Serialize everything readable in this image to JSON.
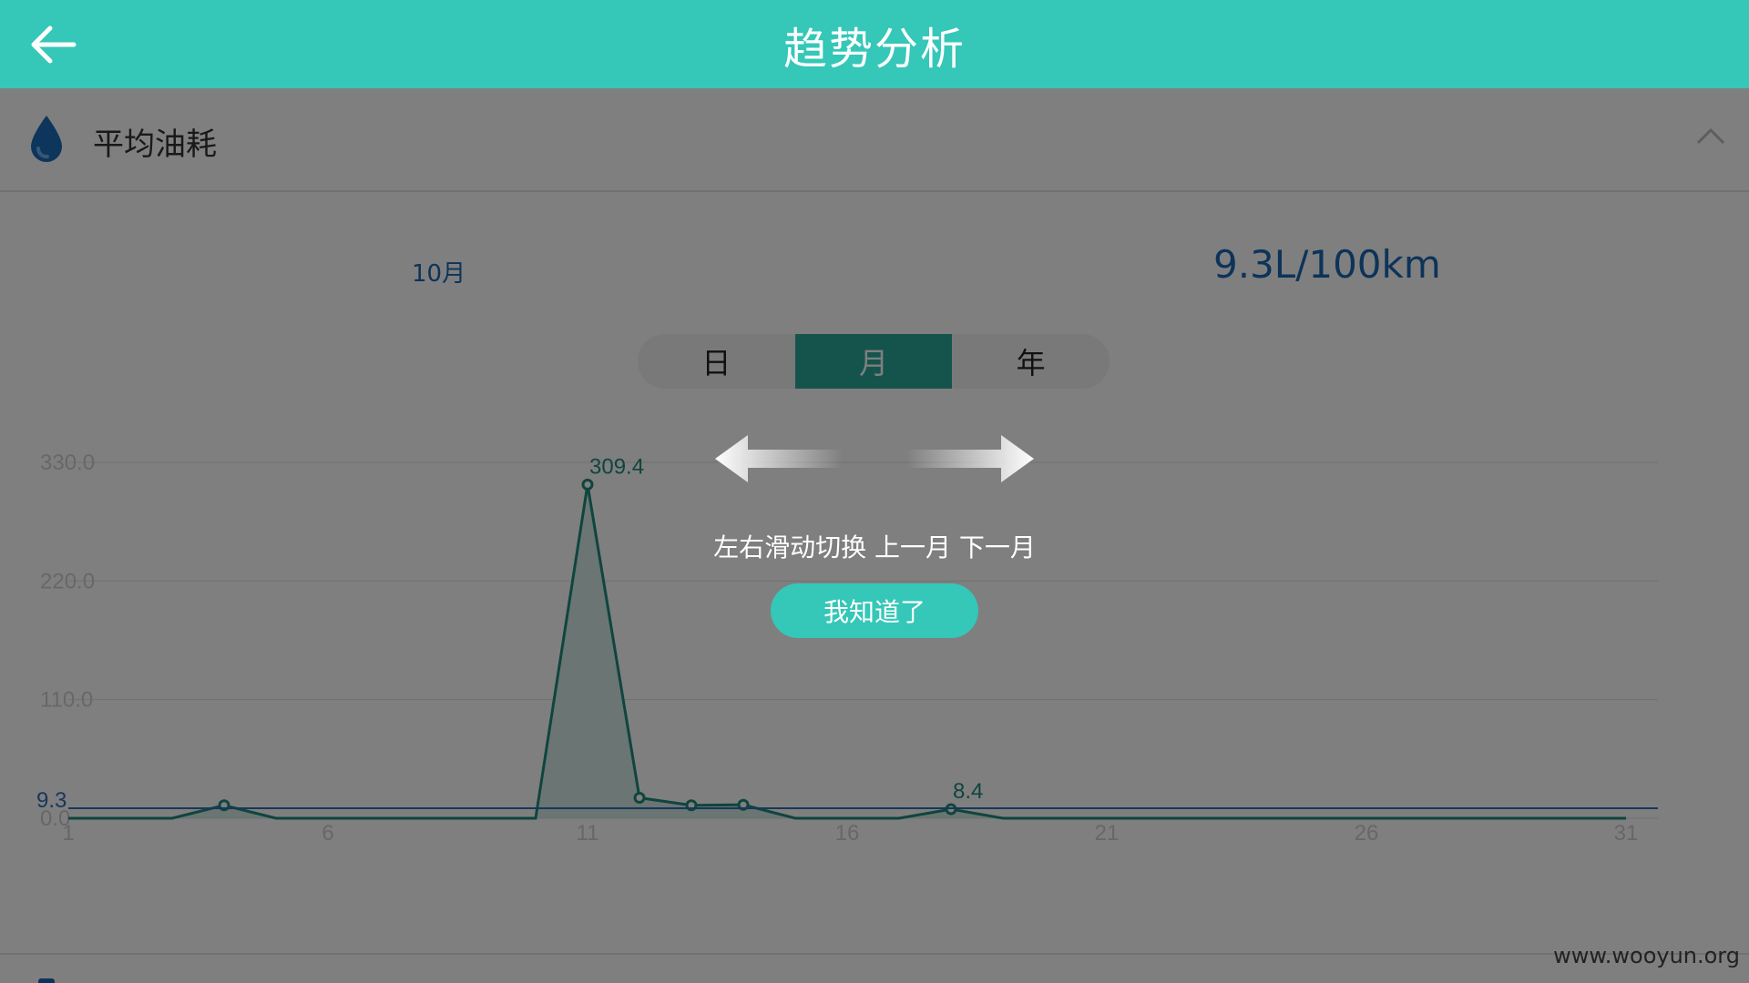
{
  "header": {
    "title": "趋势分析",
    "back_icon": "back-arrow-icon"
  },
  "section": {
    "title": "平均油耗",
    "icon": "water-drop-icon",
    "collapse_icon": "chevron-up-icon"
  },
  "summary": {
    "month": "10月",
    "average": "9.3L/100km"
  },
  "tabs": [
    {
      "label": "日",
      "active": false
    },
    {
      "label": "月",
      "active": true
    },
    {
      "label": "年",
      "active": false
    }
  ],
  "chart_data": {
    "type": "area",
    "x": [
      1,
      2,
      3,
      4,
      5,
      6,
      7,
      8,
      9,
      10,
      11,
      12,
      13,
      14,
      15,
      16,
      17,
      18,
      19,
      20,
      21,
      22,
      23,
      24,
      25,
      26,
      27,
      28,
      29,
      30,
      31
    ],
    "x_ticks": [
      "1",
      "6",
      "11",
      "16",
      "21",
      "26",
      "31"
    ],
    "y_ticks": [
      "0.0",
      "110.0",
      "220.0",
      "330.0"
    ],
    "ylim": [
      0,
      330
    ],
    "series": [
      {
        "values": [
          0,
          0,
          0,
          12,
          0,
          0,
          0,
          0,
          0,
          0,
          309.4,
          19,
          12,
          12.5,
          0,
          0,
          0,
          8.4,
          0,
          0,
          0,
          0,
          0,
          0,
          0,
          0,
          0,
          0,
          0,
          0,
          0
        ]
      }
    ],
    "point_labels": [
      {
        "x": 11,
        "text": "309.4"
      },
      {
        "x": 18,
        "text": "8.4"
      }
    ],
    "average_line": {
      "value": 9.3,
      "label": "9.3"
    },
    "line_color": "#1f8b7d",
    "fill_color": "#cfe9e5",
    "average_color": "#2f6fb5",
    "grid": true
  },
  "guide": {
    "text": "左右滑动切换 上一月 下一月",
    "button": "我知道了"
  },
  "watermark": "www.wooyun.org"
}
